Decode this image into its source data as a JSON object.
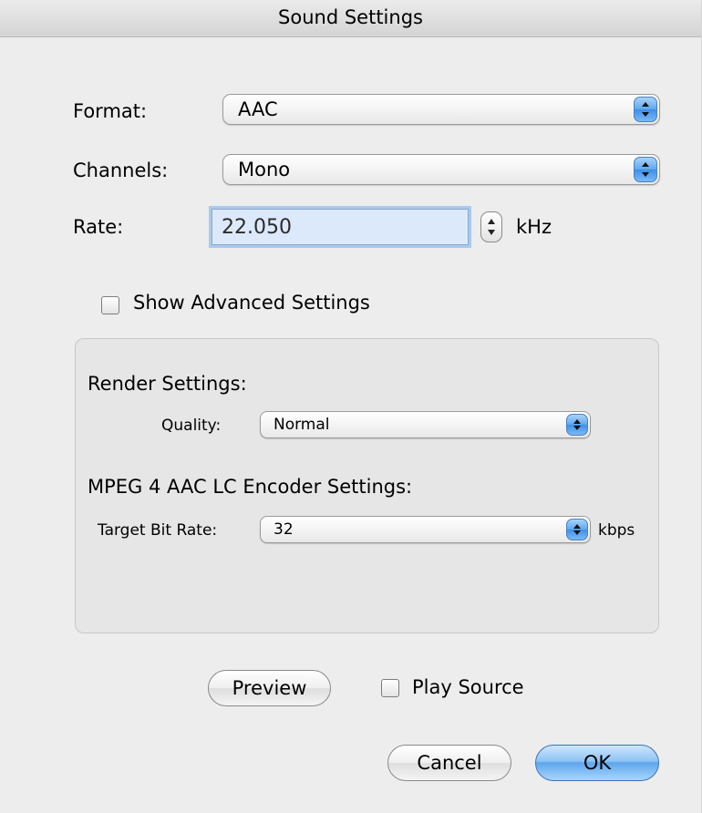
{
  "window": {
    "title": "Sound Settings"
  },
  "format": {
    "label": "Format:",
    "value": "AAC"
  },
  "channels": {
    "label": "Channels:",
    "value": "Mono"
  },
  "rate": {
    "label": "Rate:",
    "value": "22.050",
    "unit": "kHz"
  },
  "advanced": {
    "checkbox_label": "Show Advanced Settings",
    "checked": false
  },
  "render_settings": {
    "heading": "Render Settings:",
    "quality_label": "Quality:",
    "quality_value": "Normal"
  },
  "encoder_settings": {
    "heading": "MPEG 4 AAC LC Encoder Settings:",
    "bitrate_label": "Target Bit Rate:",
    "bitrate_value": "32",
    "bitrate_unit": "kbps"
  },
  "preview": {
    "button_label": "Preview",
    "play_source_label": "Play Source",
    "play_source_checked": false
  },
  "actions": {
    "cancel_label": "Cancel",
    "ok_label": "OK"
  },
  "colors": {
    "accent": "#5fa6ee",
    "focus_ring": "#a8c9f0"
  }
}
